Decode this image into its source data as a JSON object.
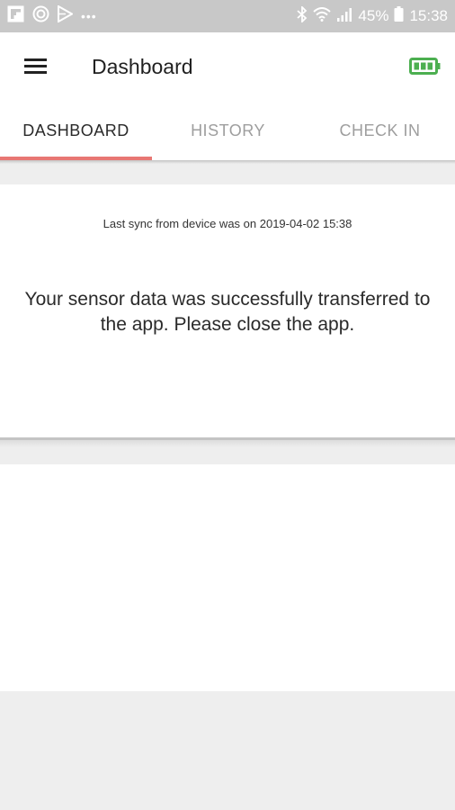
{
  "status_bar": {
    "battery_percent": "45%",
    "time": "15:38",
    "icons": [
      "flipboard-icon",
      "target-icon",
      "play-icon",
      "more-dots-icon",
      "bluetooth-icon",
      "wifi-icon",
      "signal-icon",
      "battery-icon"
    ]
  },
  "app_bar": {
    "title": "Dashboard",
    "menu_icon": "hamburger-menu-icon",
    "battery_icon": "battery-full-icon",
    "accent_color": "#4caf50"
  },
  "tabs": [
    {
      "label": "DASHBOARD",
      "active": true
    },
    {
      "label": "HISTORY",
      "active": false
    },
    {
      "label": "CHECK IN",
      "active": false
    }
  ],
  "tab_indicator_color": "#e87773",
  "card": {
    "sync_text": "Last sync from device was on 2019-04-02 15:38",
    "message": "Your sensor data was successfully transferred to the app. Please close the app."
  }
}
